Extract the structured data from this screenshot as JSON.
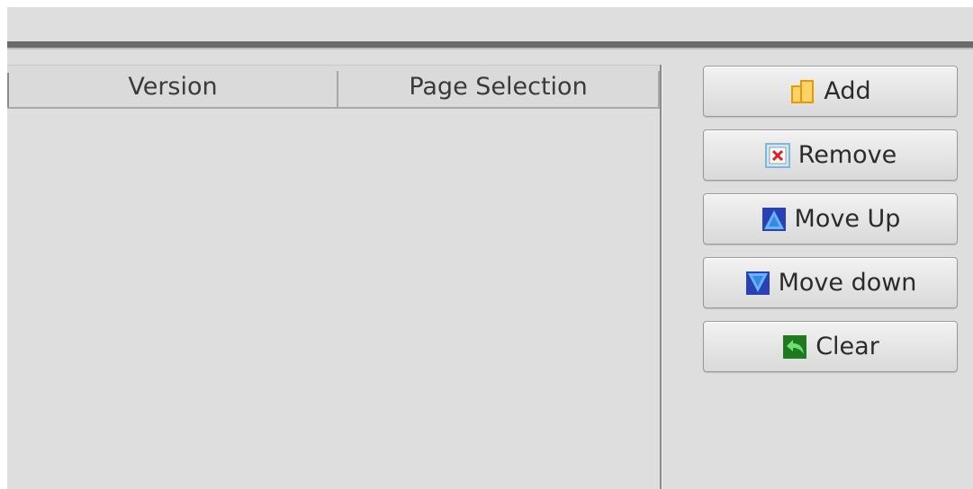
{
  "table": {
    "columns": [
      "Version",
      "Page Selection"
    ],
    "rows": []
  },
  "buttons": [
    {
      "label": "Add",
      "icon": "add-icon"
    },
    {
      "label": "Remove",
      "icon": "remove-icon"
    },
    {
      "label": "Move Up",
      "icon": "move-up-icon"
    },
    {
      "label": "Move down",
      "icon": "move-down-icon"
    },
    {
      "label": "Clear",
      "icon": "clear-icon"
    }
  ],
  "colors": {
    "panel_bg": "#dedede",
    "add_icon": "#f5b000",
    "remove_icon": "#e02020",
    "move_icon": "#2255dd",
    "clear_icon": "#1e8a1e"
  }
}
